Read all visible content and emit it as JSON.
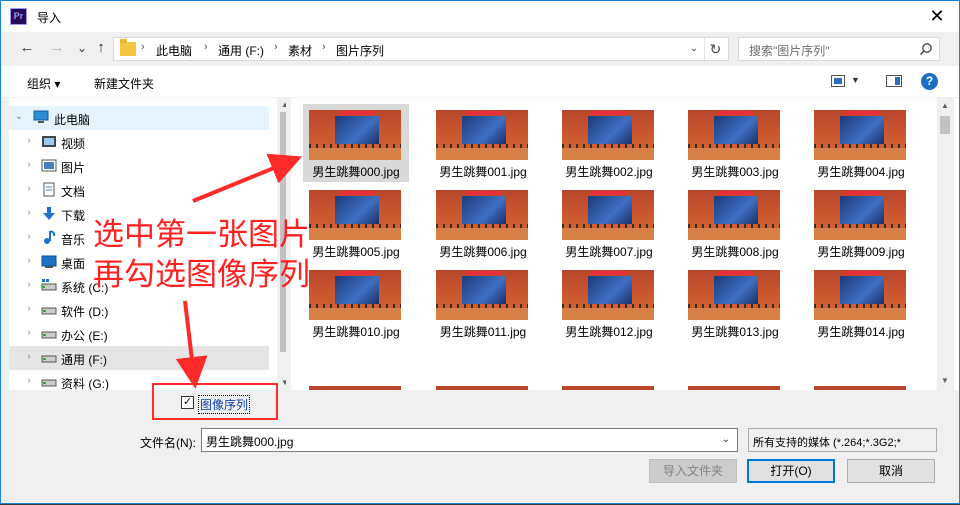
{
  "titlebar": {
    "title": "导入",
    "app_icon_text": "Pr",
    "close": "✕"
  },
  "nav": {
    "back": "←",
    "forward": "→",
    "down": "⌄",
    "up": "↑"
  },
  "address": {
    "crumbs": [
      "此电脑",
      "通用 (F:)",
      "素材",
      "图片序列"
    ],
    "separator": "›",
    "dropdown": "⌄",
    "refresh": "↻"
  },
  "search": {
    "placeholder": "搜索\"图片序列\""
  },
  "toolbar": {
    "organize": "组织 ▾",
    "new_folder": "新建文件夹",
    "help": "?"
  },
  "tree": [
    {
      "label": "此电脑",
      "icon": "computer-icon"
    },
    {
      "label": "视频",
      "icon": "video-folder-icon"
    },
    {
      "label": "图片",
      "icon": "pictures-folder-icon"
    },
    {
      "label": "文档",
      "icon": "documents-folder-icon"
    },
    {
      "label": "下载",
      "icon": "download-icon"
    },
    {
      "label": "音乐",
      "icon": "music-icon"
    },
    {
      "label": "桌面",
      "icon": "desktop-icon"
    },
    {
      "label": "系统 (C:)",
      "icon": "system-drive-icon"
    },
    {
      "label": "软件 (D:)",
      "icon": "drive-icon"
    },
    {
      "label": "办公 (E:)",
      "icon": "drive-icon"
    },
    {
      "label": "通用 (F:)",
      "icon": "drive-icon"
    },
    {
      "label": "资料 (G:)",
      "icon": "drive-icon"
    }
  ],
  "files": [
    "男生跳舞000.jpg",
    "男生跳舞001.jpg",
    "男生跳舞002.jpg",
    "男生跳舞003.jpg",
    "男生跳舞004.jpg",
    "男生跳舞005.jpg",
    "男生跳舞006.jpg",
    "男生跳舞007.jpg",
    "男生跳舞008.jpg",
    "男生跳舞009.jpg",
    "男生跳舞010.jpg",
    "男生跳舞011.jpg",
    "男生跳舞012.jpg",
    "男生跳舞013.jpg",
    "男生跳舞014.jpg"
  ],
  "selected_file_index": 0,
  "annotation": {
    "line1": "选中第一张图片",
    "line2": "再勾选图像序列",
    "color": "#ff2020"
  },
  "image_sequence": {
    "label": "图像序列",
    "checked": true,
    "mark": "✓"
  },
  "footer": {
    "filename_label": "文件名(N):",
    "filename_value": "男生跳舞000.jpg",
    "filetype": "所有支持的媒体 (*.264;*.3G2;*",
    "import_folder": "导入文件夹",
    "open": "打开(O)",
    "cancel": "取消"
  }
}
